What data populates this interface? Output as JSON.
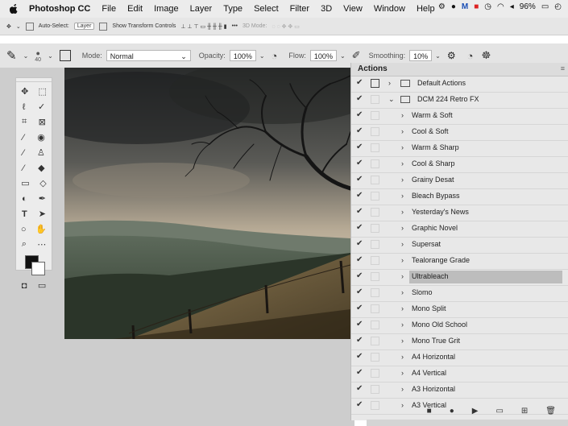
{
  "menubar": {
    "app_name": "Photoshop CC",
    "items": [
      "File",
      "Edit",
      "Image",
      "Layer",
      "Type",
      "Select",
      "Filter",
      "3D",
      "View",
      "Window",
      "Help"
    ],
    "battery": "96%"
  },
  "move_toolbar": {
    "auto_select_label": "Auto-Select:",
    "auto_select_value": "Layer",
    "show_transform_label": "Show Transform Controls",
    "mode_3d_label": "3D Mode:"
  },
  "options_bar": {
    "brush_size": "40",
    "mode_label": "Mode:",
    "mode_value": "Normal",
    "opacity_label": "Opacity:",
    "opacity_value": "100%",
    "flow_label": "Flow:",
    "flow_value": "100%",
    "smoothing_label": "Smoothing:",
    "smoothing_value": "10%"
  },
  "actions_panel": {
    "title": "Actions",
    "sets": [
      {
        "label": "Default Actions",
        "expanded": false
      },
      {
        "label": "DCM 224 Retro FX",
        "expanded": true
      }
    ],
    "actions": [
      {
        "label": "Warm & Soft"
      },
      {
        "label": "Cool & Soft"
      },
      {
        "label": "Warm & Sharp"
      },
      {
        "label": "Cool & Sharp"
      },
      {
        "label": "Grainy Desat"
      },
      {
        "label": "Bleach Bypass"
      },
      {
        "label": "Yesterday's News"
      },
      {
        "label": "Graphic Novel"
      },
      {
        "label": "Supersat"
      },
      {
        "label": "Tealorange Grade"
      },
      {
        "label": "Ultrableach",
        "selected": true
      },
      {
        "label": "Slomo"
      },
      {
        "label": "Mono Split"
      },
      {
        "label": "Mono Old School"
      },
      {
        "label": "Mono True Grit"
      },
      {
        "label": "A4 Horizontal"
      },
      {
        "label": "A4 Vertical"
      },
      {
        "label": "A3 Horizontal"
      },
      {
        "label": "A3 Vertical"
      }
    ],
    "footer_icons": [
      "stop-icon",
      "record-icon",
      "play-icon",
      "new-set-icon",
      "new-action-icon",
      "delete-icon"
    ]
  },
  "colors": {
    "selected_row": "#bdbdbd",
    "panel_bg": "#e8e8e8",
    "workspace_bg": "#cdcdcd"
  }
}
